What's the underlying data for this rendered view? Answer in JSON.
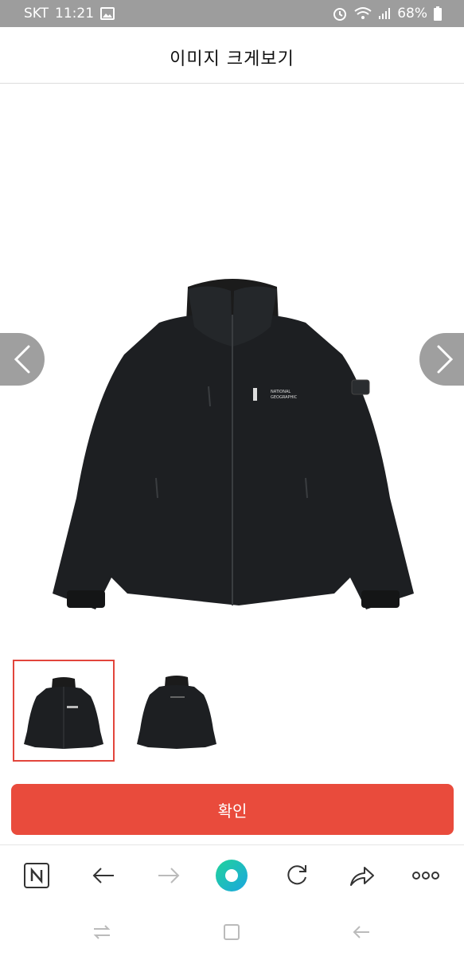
{
  "status_bar": {
    "carrier": "SKT",
    "time": "11:21",
    "battery": "68%"
  },
  "header": {
    "title": "이미지 크게보기"
  },
  "product": {
    "logo_text_line1": "NATIONAL",
    "logo_text_line2": "GEOGRAPHIC"
  },
  "gallery": {
    "thumb_count": 2,
    "selected_index": 0
  },
  "confirm_button": {
    "label": "확인"
  },
  "browser_bar": {
    "items": [
      "naver-icon",
      "back-arrow-icon",
      "forward-arrow-icon",
      "green-dot-icon",
      "refresh-icon",
      "share-icon",
      "more-icon"
    ]
  },
  "system_nav": {
    "items": [
      "recent-apps-icon",
      "home-icon",
      "back-icon"
    ]
  },
  "colors": {
    "accent_red": "#e94b3c",
    "thumb_border": "#e2453c",
    "status_bar_bg": "#9d9d9d",
    "green_dot": "#1fd59a"
  }
}
